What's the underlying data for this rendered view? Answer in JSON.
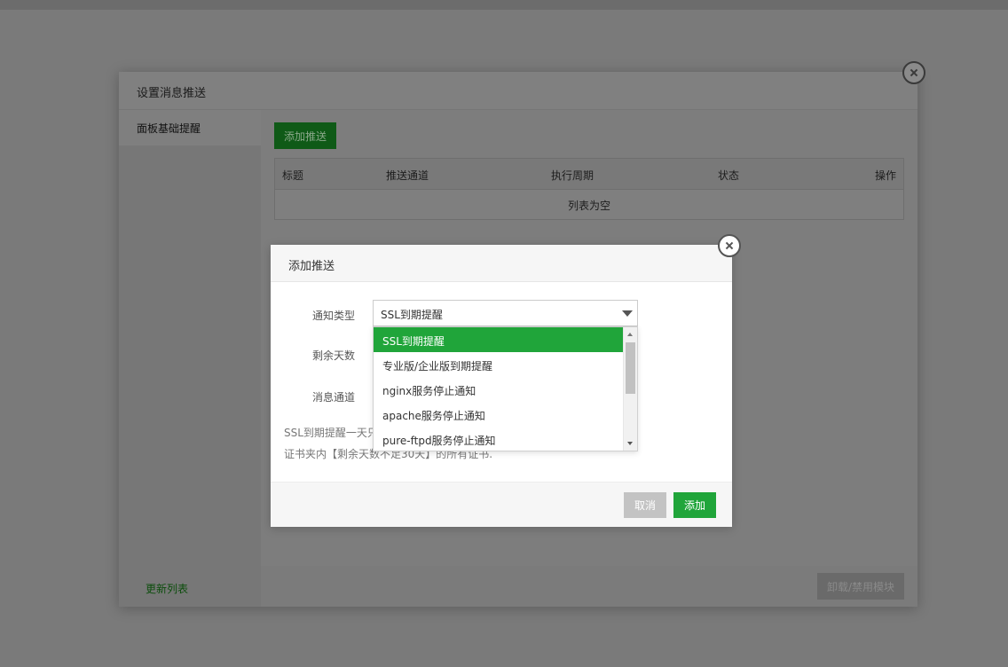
{
  "outer_dialog": {
    "title": "设置消息推送",
    "sidebar": {
      "items": [
        {
          "label": "面板基础提醒"
        }
      ],
      "refresh_label": "更新列表"
    },
    "add_push_label": "添加推送",
    "table": {
      "columns": [
        "标题",
        "推送通道",
        "执行周期",
        "状态",
        "操作"
      ],
      "empty_text": "列表为空"
    },
    "uninstall_label": "卸载/禁用模块"
  },
  "inner_dialog": {
    "title": "添加推送",
    "fields": {
      "notify_type_label": "通知类型",
      "days_label": "剩余天数",
      "channel_label": "消息通道"
    },
    "notify_type_value": "SSL到期提醒",
    "hint_line1": "SSL到期提醒一天只",
    "hint_line2": "证书夹内【剩余天数不足30天】的所有证书.",
    "cancel_label": "取消",
    "ok_label": "添加"
  },
  "dropdown": {
    "options": [
      "SSL到期提醒",
      "专业版/企业版到期提醒",
      "nginx服务停止通知",
      "apache服务停止通知",
      "pure-ftpd服务停止通知"
    ],
    "selected_index": 0
  },
  "colors": {
    "accent": "#20a53a",
    "overlay": "#7a7a7a"
  }
}
